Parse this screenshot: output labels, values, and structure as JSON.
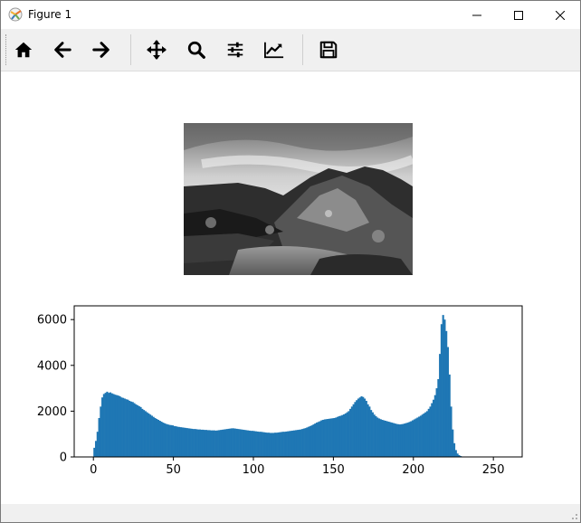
{
  "window": {
    "title": "Figure 1",
    "controls": [
      "minimize",
      "maximize",
      "close"
    ]
  },
  "toolbar": {
    "tools": [
      {
        "name": "home",
        "icon": "home-icon"
      },
      {
        "name": "back",
        "icon": "arrow-left-icon"
      },
      {
        "name": "forward",
        "icon": "arrow-right-icon"
      },
      {
        "name": "pan",
        "icon": "move-icon"
      },
      {
        "name": "zoom",
        "icon": "magnifier-icon"
      },
      {
        "name": "subplots",
        "icon": "sliders-icon"
      },
      {
        "name": "axes",
        "icon": "line-chart-icon"
      },
      {
        "name": "save",
        "icon": "floppy-disk-icon"
      }
    ]
  },
  "figure": {
    "image_subject": "grayscale photo of a rocky coastline with a tide pool under a cloudy sky"
  },
  "chart_data": {
    "type": "bar",
    "xlim": [
      -12,
      268
    ],
    "ylim": [
      0,
      6600
    ],
    "xticks": [
      0,
      50,
      100,
      150,
      200,
      250
    ],
    "yticks": [
      0,
      2000,
      4000,
      6000
    ],
    "color": "#1f77b4",
    "x": [
      0,
      1,
      2,
      3,
      4,
      5,
      6,
      7,
      8,
      9,
      10,
      11,
      12,
      13,
      14,
      15,
      16,
      17,
      18,
      19,
      20,
      21,
      22,
      23,
      24,
      25,
      26,
      27,
      28,
      29,
      30,
      31,
      32,
      33,
      34,
      35,
      36,
      37,
      38,
      39,
      40,
      41,
      42,
      43,
      44,
      45,
      46,
      47,
      48,
      49,
      50,
      51,
      52,
      53,
      54,
      55,
      56,
      57,
      58,
      59,
      60,
      61,
      62,
      63,
      64,
      65,
      66,
      67,
      68,
      69,
      70,
      71,
      72,
      73,
      74,
      75,
      76,
      77,
      78,
      79,
      80,
      81,
      82,
      83,
      84,
      85,
      86,
      87,
      88,
      89,
      90,
      91,
      92,
      93,
      94,
      95,
      96,
      97,
      98,
      99,
      100,
      101,
      102,
      103,
      104,
      105,
      106,
      107,
      108,
      109,
      110,
      111,
      112,
      113,
      114,
      115,
      116,
      117,
      118,
      119,
      120,
      121,
      122,
      123,
      124,
      125,
      126,
      127,
      128,
      129,
      130,
      131,
      132,
      133,
      134,
      135,
      136,
      137,
      138,
      139,
      140,
      141,
      142,
      143,
      144,
      145,
      146,
      147,
      148,
      149,
      150,
      151,
      152,
      153,
      154,
      155,
      156,
      157,
      158,
      159,
      160,
      161,
      162,
      163,
      164,
      165,
      166,
      167,
      168,
      169,
      170,
      171,
      172,
      173,
      174,
      175,
      176,
      177,
      178,
      179,
      180,
      181,
      182,
      183,
      184,
      185,
      186,
      187,
      188,
      189,
      190,
      191,
      192,
      193,
      194,
      195,
      196,
      197,
      198,
      199,
      200,
      201,
      202,
      203,
      204,
      205,
      206,
      207,
      208,
      209,
      210,
      211,
      212,
      213,
      214,
      215,
      216,
      217,
      218,
      219,
      220,
      221,
      222,
      223,
      224,
      225,
      226,
      227,
      228,
      229,
      230,
      231,
      232,
      233,
      234,
      235,
      236,
      237,
      238,
      239,
      240,
      241,
      242,
      243,
      244,
      245,
      246,
      247,
      248,
      249,
      250,
      251,
      252,
      253,
      254,
      255
    ],
    "values": [
      400,
      700,
      1100,
      1700,
      2200,
      2600,
      2750,
      2800,
      2850,
      2800,
      2820,
      2780,
      2750,
      2720,
      2700,
      2680,
      2650,
      2600,
      2580,
      2550,
      2520,
      2500,
      2450,
      2420,
      2400,
      2350,
      2300,
      2260,
      2220,
      2180,
      2100,
      2050,
      2000,
      1950,
      1900,
      1850,
      1800,
      1750,
      1700,
      1660,
      1620,
      1580,
      1540,
      1500,
      1470,
      1440,
      1420,
      1400,
      1390,
      1380,
      1350,
      1340,
      1320,
      1310,
      1300,
      1290,
      1280,
      1270,
      1260,
      1250,
      1240,
      1230,
      1220,
      1220,
      1210,
      1200,
      1200,
      1190,
      1190,
      1180,
      1180,
      1170,
      1170,
      1160,
      1160,
      1160,
      1150,
      1160,
      1170,
      1180,
      1190,
      1200,
      1210,
      1220,
      1230,
      1240,
      1250,
      1250,
      1240,
      1230,
      1220,
      1210,
      1200,
      1190,
      1180,
      1170,
      1160,
      1150,
      1140,
      1140,
      1130,
      1120,
      1110,
      1100,
      1100,
      1090,
      1080,
      1070,
      1060,
      1060,
      1050,
      1050,
      1050,
      1060,
      1060,
      1070,
      1080,
      1090,
      1100,
      1100,
      1110,
      1120,
      1130,
      1140,
      1150,
      1160,
      1170,
      1180,
      1190,
      1200,
      1220,
      1240,
      1260,
      1290,
      1320,
      1350,
      1380,
      1420,
      1460,
      1500,
      1530,
      1560,
      1600,
      1620,
      1640,
      1650,
      1660,
      1670,
      1680,
      1690,
      1700,
      1720,
      1750,
      1780,
      1800,
      1830,
      1860,
      1900,
      1950,
      2000,
      2100,
      2200,
      2300,
      2400,
      2480,
      2550,
      2600,
      2650,
      2620,
      2550,
      2450,
      2300,
      2200,
      2050,
      1950,
      1850,
      1780,
      1720,
      1680,
      1650,
      1620,
      1600,
      1580,
      1560,
      1540,
      1520,
      1500,
      1480,
      1460,
      1440,
      1430,
      1420,
      1430,
      1440,
      1460,
      1480,
      1500,
      1530,
      1560,
      1600,
      1640,
      1680,
      1720,
      1760,
      1800,
      1850,
      1900,
      1950,
      2000,
      2100,
      2200,
      2350,
      2500,
      2700,
      3000,
      3400,
      4500,
      5800,
      6200,
      6000,
      5500,
      4800,
      3600,
      2200,
      1200,
      600,
      300,
      150,
      80,
      40,
      20,
      10,
      5,
      0,
      0,
      0,
      0,
      0,
      0,
      0,
      0,
      0,
      0,
      0,
      0,
      0,
      0,
      0,
      0,
      0,
      0,
      0,
      0,
      0
    ]
  }
}
